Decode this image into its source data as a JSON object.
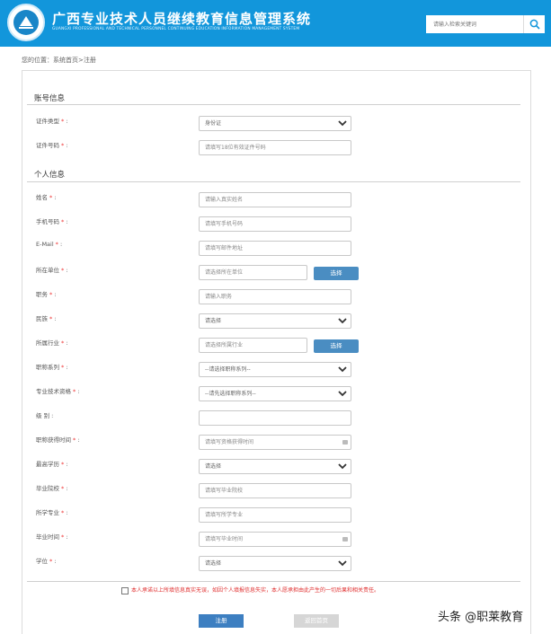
{
  "header": {
    "title": "广西专业技术人员继续教育信息管理系统",
    "subtitle": "GUANGXI PROFESSIONAL AND TECHNICAL PERSONNEL CONTINUING EDUCATION INFORMATION MANAGEMENT SYSTEM",
    "search_placeholder": "请输入检索关键词"
  },
  "breadcrumb": "您的位置：系统首页>注册",
  "sections": {
    "account": "账号信息",
    "personal": "个人信息"
  },
  "required_mark": "*",
  "fields": {
    "cert_type": {
      "label": "证件类型",
      "value": "身份证"
    },
    "cert_no": {
      "label": "证件号码",
      "placeholder": "请填写18位有效证件号码"
    },
    "name": {
      "label": "姓名",
      "placeholder": "请输入真实姓名"
    },
    "phone": {
      "label": "手机号码",
      "placeholder": "请填写手机号码"
    },
    "email": {
      "label": "E-Mail",
      "placeholder": "请填写邮件地址"
    },
    "unit": {
      "label": "所在单位",
      "placeholder": "请选择所在单位",
      "button": "选择"
    },
    "duty": {
      "label": "职务",
      "placeholder": "请输入职务"
    },
    "ethnic": {
      "label": "民族",
      "value": "请选择"
    },
    "industry": {
      "label": "所属行业",
      "placeholder": "请选择所属行业",
      "button": "选择"
    },
    "title_series": {
      "label": "职称系列",
      "value": "--请选择职称系列--"
    },
    "tech_post": {
      "label": "专业技术资格",
      "value": "--请先选择职称系列--"
    },
    "level": {
      "label": "级 别",
      "value": ""
    },
    "title_date": {
      "label": "职称获得时间",
      "placeholder": "请填写资格获得时间"
    },
    "education": {
      "label": "最高学历",
      "value": "请选择"
    },
    "school": {
      "label": "毕业院校",
      "placeholder": "请填写毕业院校"
    },
    "major": {
      "label": "所学专业",
      "placeholder": "请填写所学专业"
    },
    "grad_date": {
      "label": "毕业时间",
      "placeholder": "请填写毕业时间"
    },
    "degree": {
      "label": "学位",
      "value": "请选择"
    }
  },
  "agreement": "本人承诺以上所填信息真实无误，如因个人填报信息失实，本人愿承担由此产生的一切后果和相关责任。",
  "buttons": {
    "register": "注册",
    "back": "返回首页"
  },
  "watermark": "头条 @职莱教育",
  "colors": {
    "header_bg": "#1296db",
    "required": "#e33333",
    "primary_button": "#3d7fc1"
  }
}
